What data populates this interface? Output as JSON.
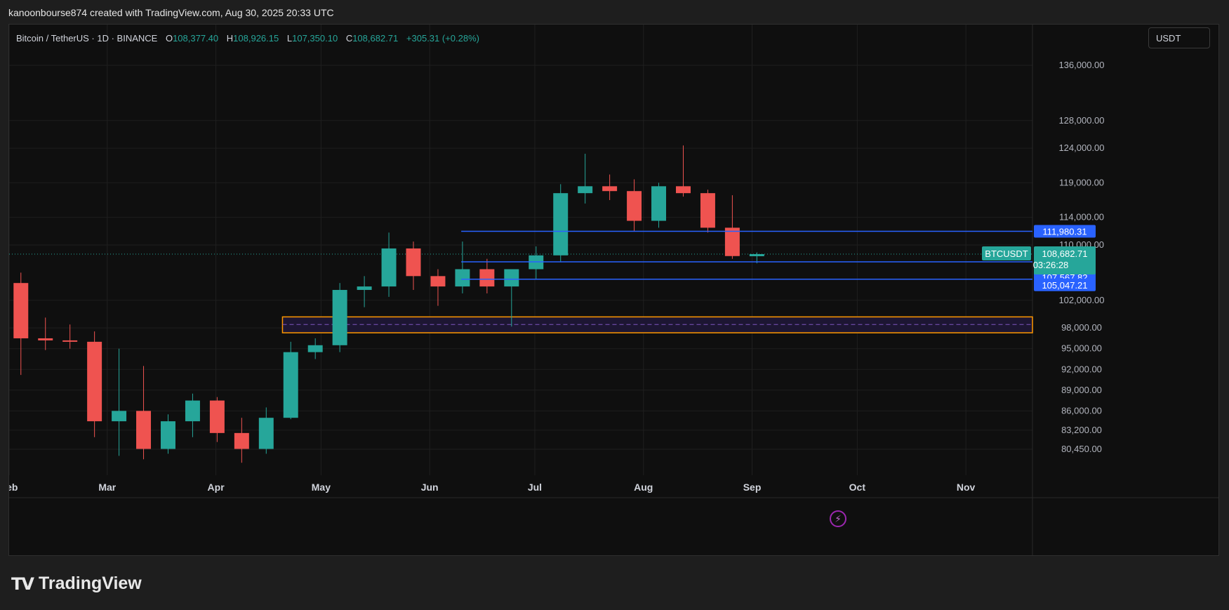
{
  "caption": "kanoonbourse874 created with TradingView.com, Aug 30, 2025 20:33 UTC",
  "brand": {
    "logo_glyph": "TV",
    "name": "TradingView"
  },
  "currency_button": "USDT",
  "legend": {
    "symbol": "Bitcoin / TetherUS · 1D · BINANCE",
    "o_label": "O",
    "o": "108,377.40",
    "h_label": "H",
    "h": "108,926.15",
    "l_label": "L",
    "l": "107,350.10",
    "c_label": "C",
    "c": "108,682.71",
    "change": "+305.31 (+0.28%)"
  },
  "colors": {
    "up": "#26a69a",
    "down": "#ef5350",
    "level_line": "#2962ff",
    "zone_border": "#ff9800",
    "zone_fill": "#1d1633",
    "zone_mid": "#7e57c2",
    "grid": "#1f1f1f"
  },
  "chart_data": {
    "type": "candlestick",
    "x_range": [
      "2025-02-01",
      "2025-11-20"
    ],
    "y_ticks": [
      80450,
      83200,
      86000,
      89000,
      92000,
      95000,
      98000,
      102000,
      110000,
      114000,
      119000,
      124000,
      128000,
      136000
    ],
    "y_tick_labels": [
      "80,450.00",
      "83,200.00",
      "86,000.00",
      "89,000.00",
      "92,000.00",
      "95,000.00",
      "98,000.00",
      "102,000.00",
      "110,000.00",
      "114,000.00",
      "119,000.00",
      "124,000.00",
      "128,000.00",
      "136,000.00"
    ],
    "x_ticks": [
      {
        "label": "Feb",
        "date": "2025-02-01"
      },
      {
        "label": "Mar",
        "date": "2025-03-01"
      },
      {
        "label": "Apr",
        "date": "2025-04-01"
      },
      {
        "label": "May",
        "date": "2025-05-01"
      },
      {
        "label": "Jun",
        "date": "2025-06-01"
      },
      {
        "label": "Jul",
        "date": "2025-07-01"
      },
      {
        "label": "Aug",
        "date": "2025-08-01"
      },
      {
        "label": "Sep",
        "date": "2025-09-01"
      },
      {
        "label": "Oct",
        "date": "2025-10-01"
      },
      {
        "label": "Nov",
        "date": "2025-11-01"
      }
    ],
    "ohlc_weekly": [
      {
        "date": "2025-02-01",
        "o": 104500,
        "h": 106000,
        "l": 91200,
        "c": 96500
      },
      {
        "date": "2025-02-08",
        "o": 96500,
        "h": 99500,
        "l": 94800,
        "c": 96200
      },
      {
        "date": "2025-02-15",
        "o": 96200,
        "h": 98500,
        "l": 95000,
        "c": 96000
      },
      {
        "date": "2025-02-22",
        "o": 96000,
        "h": 97500,
        "l": 82200,
        "c": 84500
      },
      {
        "date": "2025-03-01",
        "o": 84500,
        "h": 95000,
        "l": 79500,
        "c": 86000
      },
      {
        "date": "2025-03-08",
        "o": 86000,
        "h": 92500,
        "l": 79000,
        "c": 80500
      },
      {
        "date": "2025-03-15",
        "o": 80500,
        "h": 85500,
        "l": 79800,
        "c": 84500
      },
      {
        "date": "2025-03-22",
        "o": 84500,
        "h": 88500,
        "l": 82200,
        "c": 87500
      },
      {
        "date": "2025-03-29",
        "o": 87500,
        "h": 88000,
        "l": 81500,
        "c": 82800
      },
      {
        "date": "2025-04-05",
        "o": 82800,
        "h": 85000,
        "l": 78500,
        "c": 80500
      },
      {
        "date": "2025-04-12",
        "o": 80500,
        "h": 86500,
        "l": 79800,
        "c": 85000
      },
      {
        "date": "2025-04-19",
        "o": 85000,
        "h": 96000,
        "l": 84800,
        "c": 94500
      },
      {
        "date": "2025-04-26",
        "o": 94500,
        "h": 96500,
        "l": 93500,
        "c": 95500
      },
      {
        "date": "2025-05-03",
        "o": 95500,
        "h": 104500,
        "l": 94500,
        "c": 103500
      },
      {
        "date": "2025-05-10",
        "o": 103500,
        "h": 105500,
        "l": 101000,
        "c": 104000
      },
      {
        "date": "2025-05-17",
        "o": 104000,
        "h": 111800,
        "l": 102500,
        "c": 109500
      },
      {
        "date": "2025-05-24",
        "o": 109500,
        "h": 110500,
        "l": 103500,
        "c": 105500
      },
      {
        "date": "2025-05-31",
        "o": 105500,
        "h": 106500,
        "l": 101200,
        "c": 104000
      },
      {
        "date": "2025-06-07",
        "o": 104000,
        "h": 110500,
        "l": 103000,
        "c": 106500
      },
      {
        "date": "2025-06-14",
        "o": 106500,
        "h": 108000,
        "l": 103000,
        "c": 104000
      },
      {
        "date": "2025-06-21",
        "o": 104000,
        "h": 106000,
        "l": 98200,
        "c": 106500
      },
      {
        "date": "2025-06-28",
        "o": 106500,
        "h": 109800,
        "l": 105000,
        "c": 108500
      },
      {
        "date": "2025-07-05",
        "o": 108500,
        "h": 118800,
        "l": 107500,
        "c": 117500
      },
      {
        "date": "2025-07-12",
        "o": 117500,
        "h": 123200,
        "l": 116000,
        "c": 118500
      },
      {
        "date": "2025-07-19",
        "o": 118500,
        "h": 120200,
        "l": 116500,
        "c": 117800
      },
      {
        "date": "2025-07-26",
        "o": 117800,
        "h": 119500,
        "l": 112000,
        "c": 113500
      },
      {
        "date": "2025-08-02",
        "o": 113500,
        "h": 119000,
        "l": 112500,
        "c": 118500
      },
      {
        "date": "2025-08-09",
        "o": 118500,
        "h": 124400,
        "l": 117000,
        "c": 117500
      },
      {
        "date": "2025-08-16",
        "o": 117500,
        "h": 118000,
        "l": 111800,
        "c": 112500
      },
      {
        "date": "2025-08-23",
        "o": 112500,
        "h": 117200,
        "l": 108000,
        "c": 108400
      },
      {
        "date": "2025-08-30",
        "o": 108377.4,
        "h": 108926.15,
        "l": 107350.1,
        "c": 108682.71
      }
    ],
    "horizontal_levels": [
      {
        "value": 111980.31,
        "label": "111,980.31",
        "from": "2025-06-10"
      },
      {
        "value": 107567.82,
        "label": "107,567.82",
        "from": "2025-06-10"
      },
      {
        "value": 105047.21,
        "label": "105,047.21",
        "from": "2025-06-10"
      }
    ],
    "support_zone": {
      "low": 97300,
      "high": 99600,
      "mid": 98500,
      "from": "2025-04-20"
    },
    "last_price": {
      "symbol": "BTCUSDT",
      "value": 108682.71,
      "label": "108,682.71",
      "countdown": "03:26:28"
    }
  }
}
